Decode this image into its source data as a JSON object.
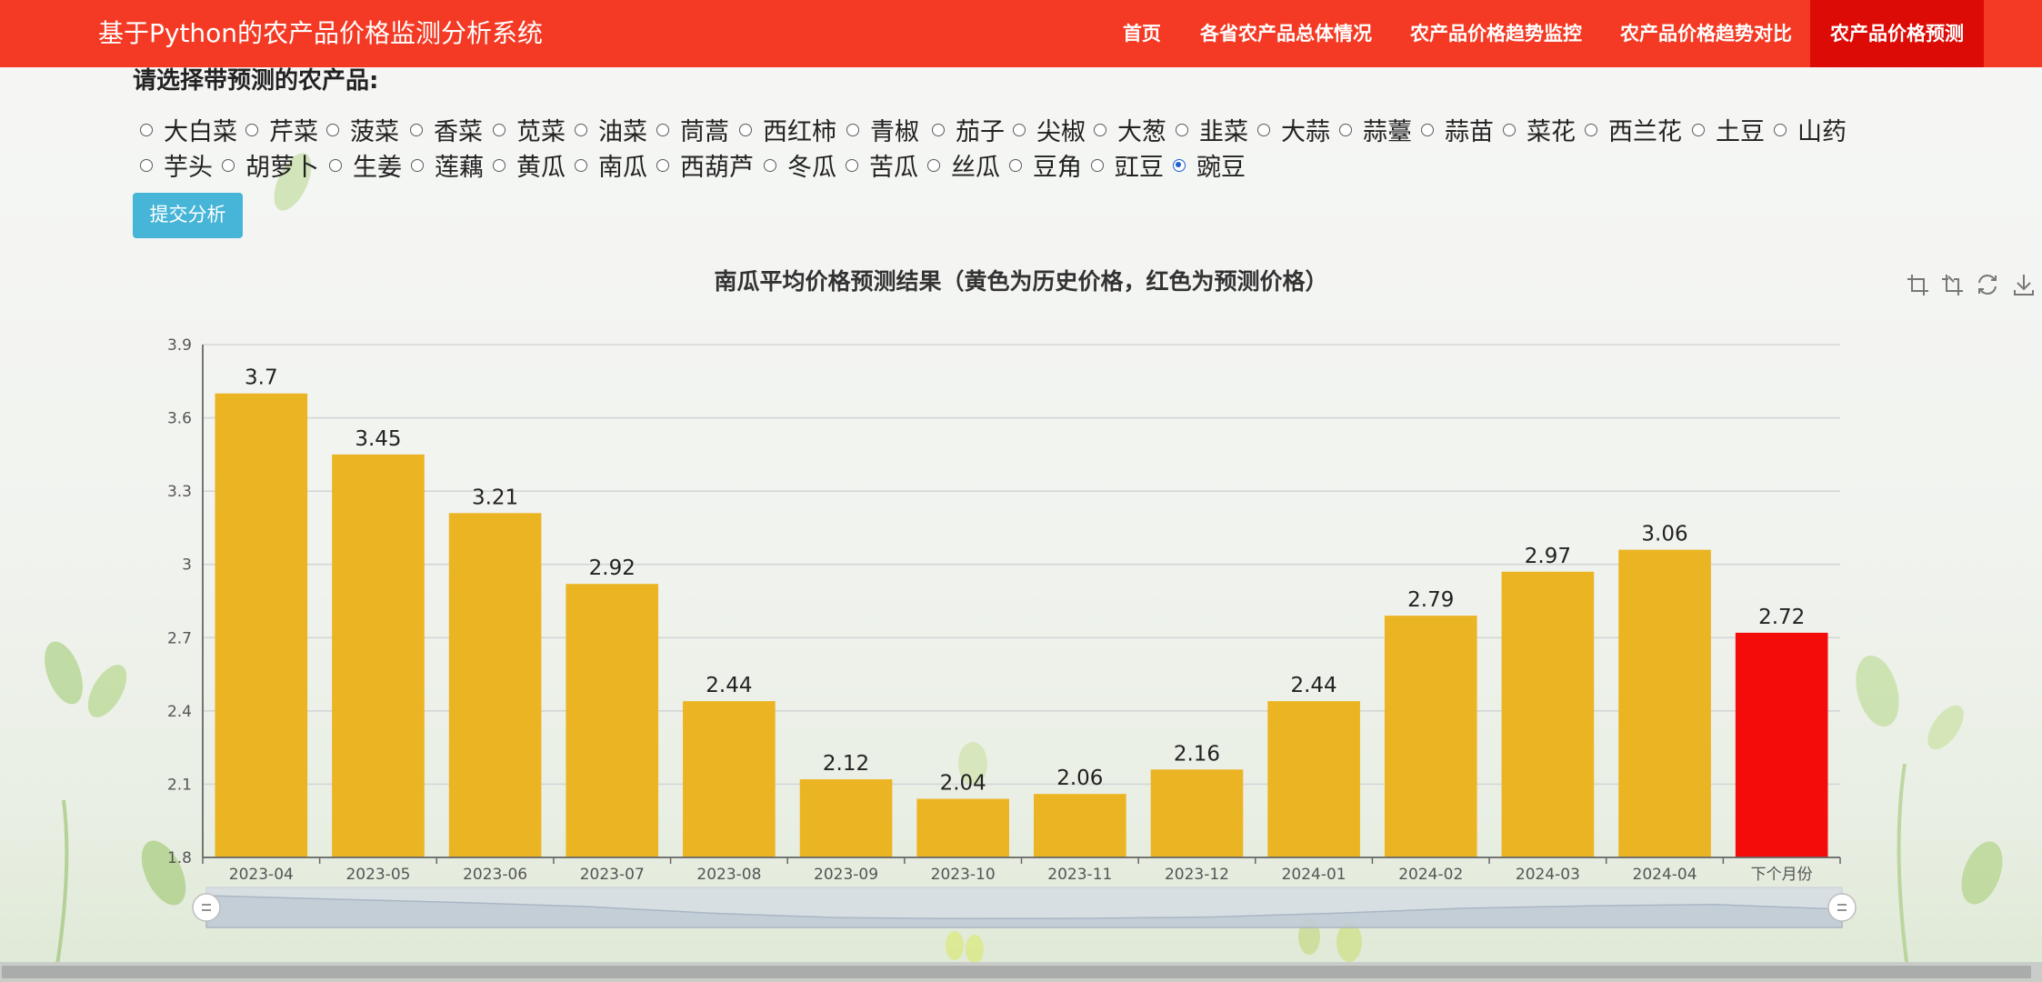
{
  "app": {
    "title": "基于Python的农产品价格监测分析系统"
  },
  "nav": {
    "items": [
      {
        "label": "首页"
      },
      {
        "label": "各省农产品总体情况"
      },
      {
        "label": "农产品价格趋势监控"
      },
      {
        "label": "农产品价格趋势对比"
      },
      {
        "label": "农产品价格预测",
        "active": true
      }
    ]
  },
  "form": {
    "prompt": "请选择带预测的农产品:",
    "options": [
      "大白菜",
      "芹菜",
      "菠菜",
      "香菜",
      "苋菜",
      "油菜",
      "茼蒿",
      "西红柿",
      "青椒",
      "茄子",
      "尖椒",
      "大葱",
      "韭菜",
      "大蒜",
      "蒜薹",
      "蒜苗",
      "菜花",
      "西兰花",
      "土豆",
      "山药",
      "芋头",
      "胡萝卜",
      "生姜",
      "莲藕",
      "黄瓜",
      "南瓜",
      "西葫芦",
      "冬瓜",
      "苦瓜",
      "丝瓜",
      "豆角",
      "豇豆",
      "豌豆"
    ],
    "selected": "豌豆",
    "submit_label": "提交分析"
  },
  "toolbox": [
    "zoom-icon",
    "zoom-reset-icon",
    "restore-icon",
    "download-icon"
  ],
  "colors": {
    "nav_bg": "#f43a24",
    "nav_active": "#dd0b06",
    "history_bar": "#ebb423",
    "forecast_bar": "#f40c0a",
    "button": "#46b5d7"
  },
  "chart_data": {
    "type": "bar",
    "title": "南瓜平均价格预测结果（黄色为历史价格，红色为预测价格）",
    "xlabel": "",
    "ylabel": "",
    "categories": [
      "2023-04",
      "2023-05",
      "2023-06",
      "2023-07",
      "2023-08",
      "2023-09",
      "2023-10",
      "2023-11",
      "2023-12",
      "2024-01",
      "2024-02",
      "2024-03",
      "2024-04",
      "下个月份"
    ],
    "values": [
      3.7,
      3.45,
      3.21,
      2.92,
      2.44,
      2.12,
      2.04,
      2.06,
      2.16,
      2.44,
      2.79,
      2.97,
      3.06,
      2.72
    ],
    "value_labels": [
      "3.7",
      "3.45",
      "3.21",
      "2.92",
      "2.44",
      "2.12",
      "2.04",
      "2.06",
      "2.16",
      "2.44",
      "2.79",
      "2.97",
      "3.06",
      "2.72"
    ],
    "ylim": [
      1.8,
      3.9
    ],
    "yticks": [
      1.8,
      2.1,
      2.4,
      2.7,
      3,
      3.3,
      3.6,
      3.9
    ],
    "ytick_labels": [
      "1.8",
      "2.1",
      "2.4",
      "2.7",
      "3",
      "3.3",
      "3.6",
      "3.9"
    ],
    "grid": true,
    "legend": "none",
    "datazoom": true
  }
}
